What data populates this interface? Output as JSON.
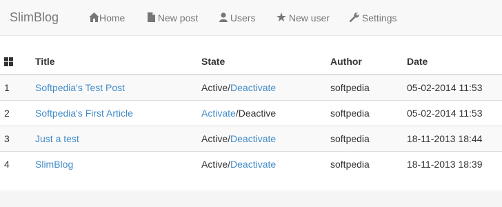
{
  "navbar": {
    "brand": "SlimBlog",
    "items": [
      {
        "label": "Home",
        "icon": "home-icon"
      },
      {
        "label": "New post",
        "icon": "file-icon"
      },
      {
        "label": "Users",
        "icon": "user-icon"
      },
      {
        "label": "New user",
        "icon": "star-icon"
      },
      {
        "label": "Settings",
        "icon": "wrench-icon"
      }
    ]
  },
  "table": {
    "header_icon": "grid-icon",
    "columns": [
      "Title",
      "State",
      "Author",
      "Date"
    ],
    "rows": [
      {
        "num": "1",
        "title": "Softpedia's Test Post",
        "state_a": "Active",
        "sep": "/",
        "state_b": "Deactivate",
        "author": "softpedia",
        "date": "05-02-2014 11:53"
      },
      {
        "num": "2",
        "title": "Softpedia's First Article",
        "state_a": "Activate",
        "sep": "/",
        "state_b": "Deactive",
        "author": "softpedia",
        "date": "05-02-2014 11:53"
      },
      {
        "num": "3",
        "title": "Just a test",
        "state_a": "Active",
        "sep": "/",
        "state_b": "Deactivate",
        "author": "softpedia",
        "date": "18-11-2013 18:44"
      },
      {
        "num": "4",
        "title": "SlimBlog",
        "state_a": "Active",
        "sep": "/",
        "state_b": "Deactivate",
        "author": "softpedia",
        "date": "18-11-2013 18:39"
      }
    ]
  },
  "colors": {
    "link": "#428bca",
    "navbar_bg": "#f8f8f8",
    "nav_text": "#777777"
  }
}
